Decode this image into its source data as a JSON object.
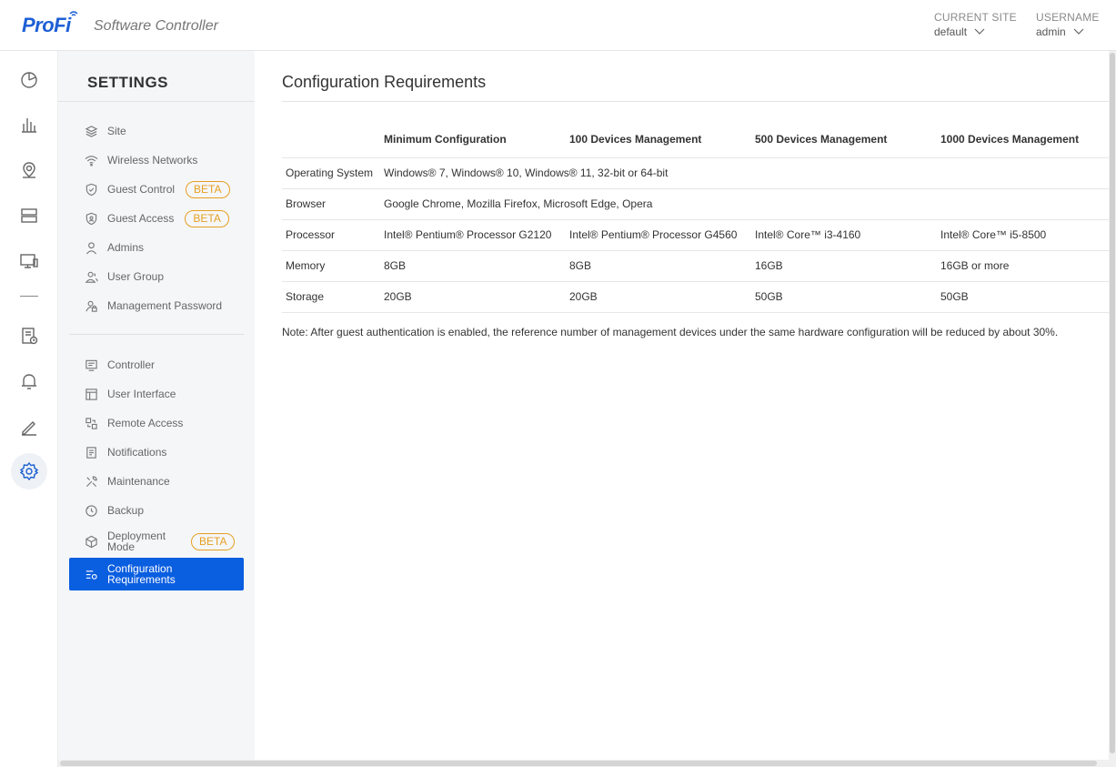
{
  "header": {
    "logo": "ProFi",
    "app_name": "Software Controller",
    "site_label": "CURRENT SITE",
    "site_value": "default",
    "user_label": "USERNAME",
    "user_value": "admin"
  },
  "rail": {
    "items": [
      {
        "name": "dashboard-icon"
      },
      {
        "name": "statistics-icon"
      },
      {
        "name": "map-icon"
      },
      {
        "name": "devices-icon"
      },
      {
        "name": "clients-icon"
      },
      {
        "name": "logs-icon"
      },
      {
        "name": "alerts-icon"
      },
      {
        "name": "edit-icon"
      },
      {
        "name": "settings-icon",
        "active": true
      }
    ]
  },
  "sidebar": {
    "title": "SETTINGS",
    "badge": "BETA",
    "items": [
      {
        "label": "Site"
      },
      {
        "label": "Wireless Networks"
      },
      {
        "label": "Guest Control"
      },
      {
        "label": "Guest Access"
      },
      {
        "label": "Admins"
      },
      {
        "label": "User Group"
      },
      {
        "label": "Management Password"
      },
      {
        "label": "Controller"
      },
      {
        "label": "User Interface"
      },
      {
        "label": "Remote Access"
      },
      {
        "label": "Notifications"
      },
      {
        "label": "Maintenance"
      },
      {
        "label": "Backup"
      },
      {
        "label": "Deployment Mode"
      },
      {
        "label": "Configuration Requirements"
      }
    ]
  },
  "main": {
    "title": "Configuration Requirements",
    "table": {
      "headers": [
        "",
        "Minimum Configuration",
        "100 Devices Management",
        "500 Devices Management",
        "1000 Devices Management"
      ],
      "rows": [
        [
          "Operating System",
          "Windows® 7, Windows® 10, Windows® 11, 32-bit or 64-bit",
          "",
          "",
          ""
        ],
        [
          "Browser",
          "Google Chrome, Mozilla Firefox, Microsoft Edge, Opera",
          "",
          "",
          ""
        ],
        [
          "Processor",
          "Intel® Pentium® Processor G2120",
          "Intel® Pentium® Processor G4560",
          "Intel® Core™ i3-4160",
          "Intel® Core™ i5-8500"
        ],
        [
          "Memory",
          "8GB",
          "8GB",
          "16GB",
          "16GB or more"
        ],
        [
          "Storage",
          "20GB",
          "20GB",
          "50GB",
          "50GB"
        ]
      ]
    },
    "note": "Note: After guest authentication is enabled, the reference number of management devices under the same hardware configuration will be reduced by about 30%."
  },
  "colors": {
    "accent": "#0a5ee0",
    "brand": "#1d5fd6",
    "beta": "#e6a021"
  }
}
